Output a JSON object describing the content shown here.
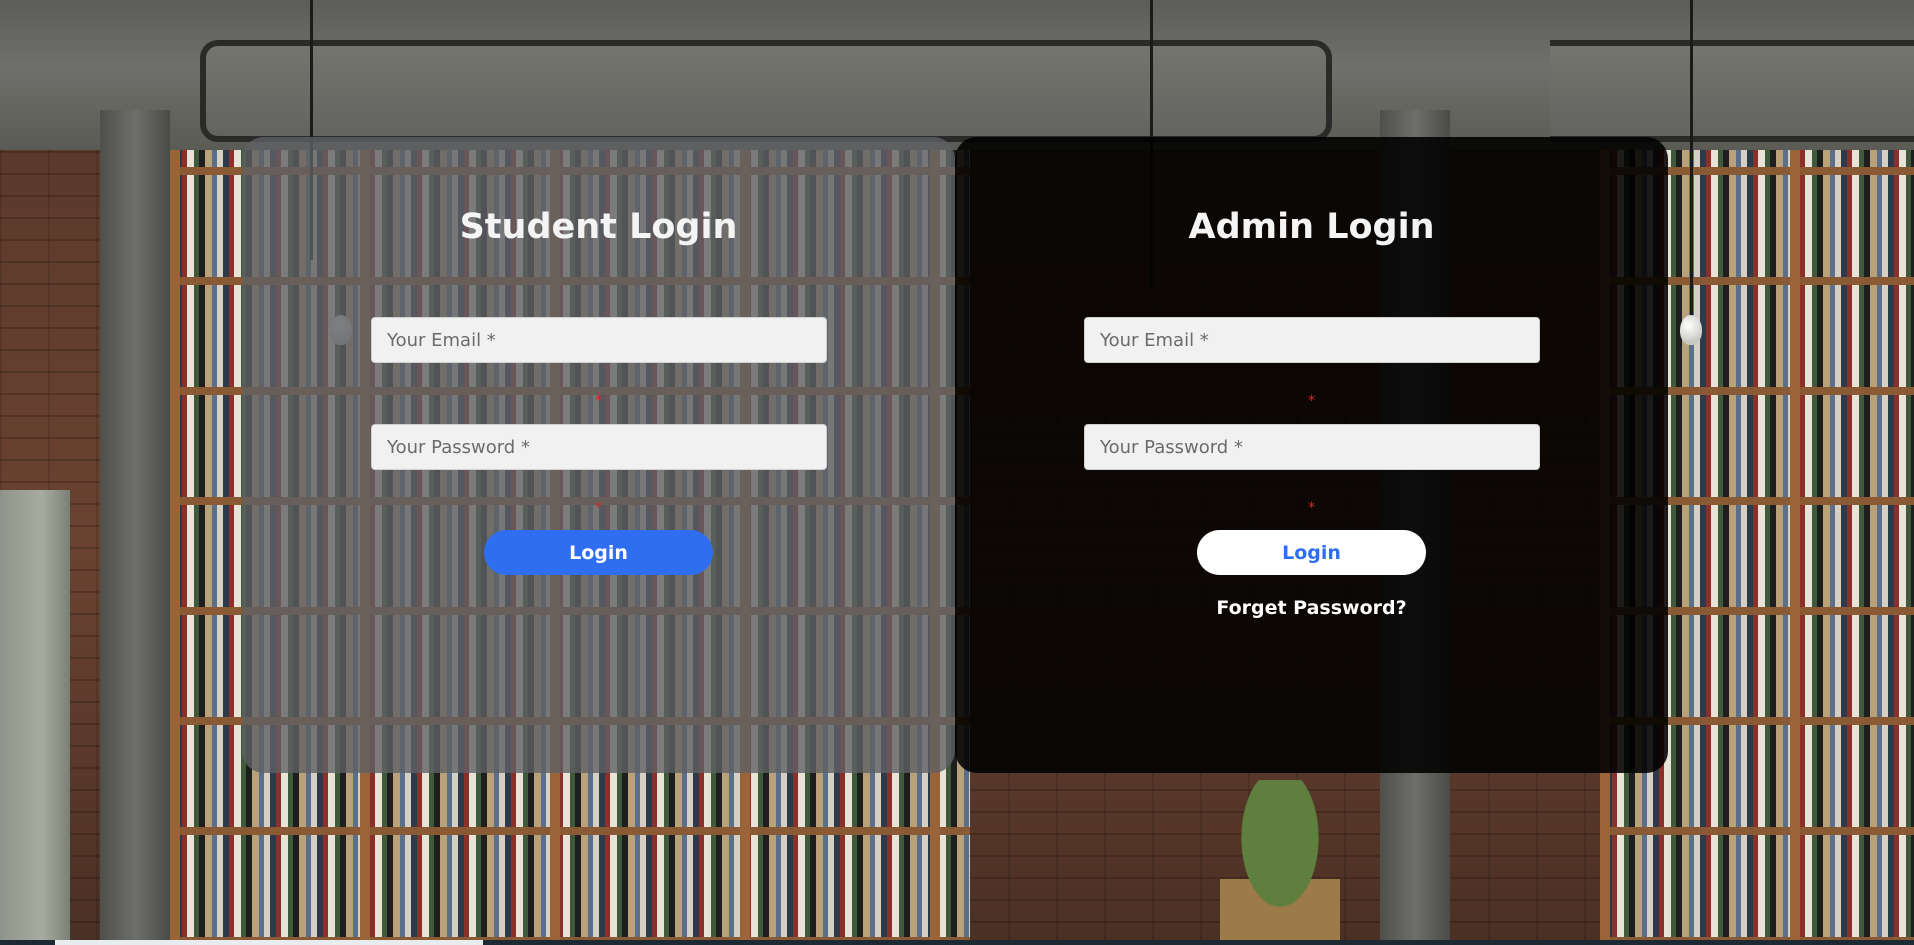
{
  "student": {
    "title": "Student Login",
    "email_placeholder": "Your Email *",
    "password_placeholder": "Your Password *",
    "required_marker": "*",
    "login_label": "Login"
  },
  "admin": {
    "title": "Admin Login",
    "email_placeholder": "Your Email *",
    "password_placeholder": "Your Password *",
    "required_marker": "*",
    "login_label": "Login",
    "forget_password_label": "Forget Password?"
  },
  "colors": {
    "student_panel": "#5f6064",
    "admin_panel": "#000000",
    "primary_button": "#2f6ef0",
    "required_marker": "#e0251b"
  }
}
